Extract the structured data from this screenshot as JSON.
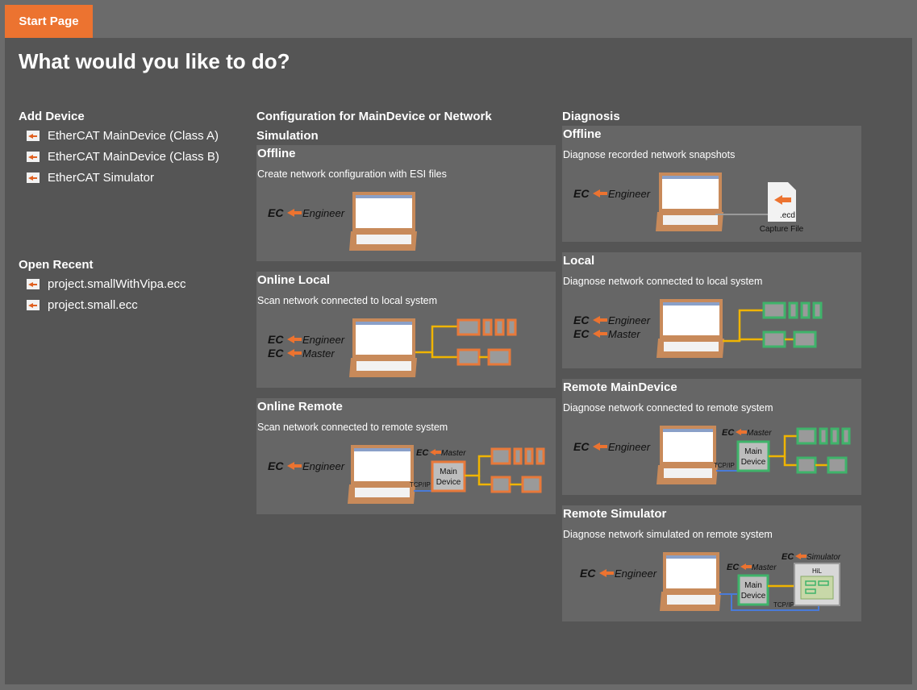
{
  "tab": {
    "label": "Start Page"
  },
  "heading": "What would you like to do?",
  "add_device": {
    "title": "Add Device",
    "items": [
      {
        "label": "EtherCAT MainDevice (Class A)"
      },
      {
        "label": "EtherCAT MainDevice (Class B)"
      },
      {
        "label": "EtherCAT Simulator"
      }
    ]
  },
  "open_recent": {
    "title": "Open Recent",
    "items": [
      {
        "label": "project.smallWithVipa.ecc"
      },
      {
        "label": "project.small.ecc"
      }
    ]
  },
  "config": {
    "title_line1": "Configuration for MainDevice or Network",
    "title_line2": "Simulation",
    "cards": [
      {
        "title": "Offline",
        "desc": "Create network configuration with ESI files"
      },
      {
        "title": "Online Local",
        "desc": "Scan network connected to local system"
      },
      {
        "title": "Online Remote",
        "desc": "Scan network connected to remote system"
      }
    ]
  },
  "diagnosis": {
    "title": "Diagnosis",
    "cards": [
      {
        "title": "Offline",
        "desc": "Diagnose recorded network snapshots"
      },
      {
        "title": "Local",
        "desc": "Diagnose network connected to local system"
      },
      {
        "title": "Remote MainDevice",
        "desc": "Diagnose network connected to remote system"
      },
      {
        "title": "Remote Simulator",
        "desc": "Diagnose network simulated on remote system"
      }
    ]
  },
  "illustration": {
    "ec": "EC",
    "engineer": "Engineer",
    "master": "Master",
    "simulator": "Simulator",
    "main": "Main",
    "device": "Device",
    "tcpip": "TCP/IP",
    "ecd": ".ecd",
    "capture_file": "Capture File",
    "hil": "HiL"
  },
  "colors": {
    "accent": "#ec7330",
    "panel": "#555555",
    "card": "#666666",
    "config_node": "#e8793a",
    "diag_node": "#3fb36a",
    "cable": "#f0b400",
    "tcp": "#4a7bd8"
  }
}
